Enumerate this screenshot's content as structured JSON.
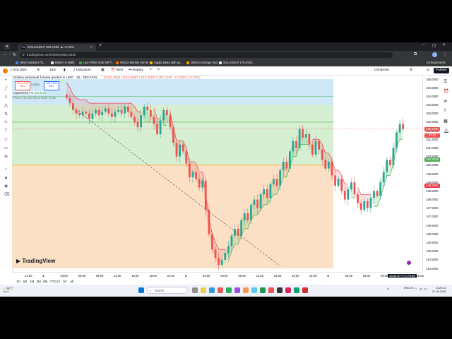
{
  "browser": {
    "tab_title": "SOLUSDLP 152.1200 ▲+2.04%",
    "url": "tradingview.com/chart/OMELN6N/",
    "all_bookmarks": "All Bookmarks",
    "bookmarks": [
      "Hindi Numbers To...",
      "Bihari | e-Nidhi",
      "Live FREE NSE NIFT...",
      "WSO2 Identity Server",
      "Sujala baiku with yu...",
      "Delta Exchange mid...",
      "SOLUSDLP 178.6150..."
    ]
  },
  "header": {
    "symbol": "SOLUSD",
    "interval": "15m",
    "indicators": "Indicators",
    "alert": "Alert",
    "replay": "Replay",
    "layout_name": "Unnamed",
    "publish": "Publish"
  },
  "legend": {
    "title": "Solana perpetual futures quoted in USD · 15 · DELTAIN",
    "ohlc": "O152.4610 H152.5860 L152.0400 C152.1200 −0.3300 (−0.22%)",
    "sell_price": "152.1 000",
    "sell_label": "SELL",
    "spread": "0.0250",
    "buy_price": "152.1250",
    "buy_label": "BUY",
    "indicator1": "Supertrend 7 5",
    "indicator1_value": "150.3018",
    "indicator2": "Pivot 4 30 180 show close mode"
  },
  "price_axis": {
    "labels": [
      "155.0000",
      "154.5000",
      "154.0000",
      "153.5000",
      "153.0000",
      "152.5000",
      "152.0000",
      "151.5000",
      "151.0000",
      "150.5000",
      "150.0000",
      "149.5000",
      "149.0000",
      "148.5000",
      "148.0000",
      "147.5000",
      "147.0000",
      "146.5000",
      "146.0000",
      "145.5000",
      "145.0000",
      "144.5000",
      "144.0000"
    ],
    "current_price": "152.1200",
    "countdown": "03:17",
    "supertrend_tag": "150.3018",
    "red_tag": "148.8000"
  },
  "time_axis": {
    "labels": [
      "21:00",
      "3",
      "03:00",
      "06:00",
      "09:00",
      "12:00",
      "15:00",
      "18:00",
      "21:00",
      "4",
      "03:00",
      "06:00",
      "09:00",
      "12:00",
      "15:00",
      "18:00",
      "21:00",
      "5",
      "03:00",
      "06:00",
      "09:00",
      "12:00",
      "15:00"
    ],
    "cursor_time": "13:22:45 UTC+5:30"
  },
  "watermark": "TradingView",
  "ranges": [
    "1D",
    "5D",
    "1M",
    "3M",
    "6M",
    "YTD",
    "1Y",
    "5Y",
    "All"
  ],
  "bottom_tabs": [
    "Crypto Pairs Screener",
    "Pine Editor",
    "Strategy Tester",
    "Replay Trading",
    "Trading Panel"
  ],
  "taskbar": {
    "weather_temp": "28°C",
    "weather_desc": "Haze",
    "search_placeholder": "Search",
    "lang": "ENG IN",
    "time": "13:22:44",
    "date": "07-06-2025"
  },
  "colors": {
    "candle_up": "#26a69a",
    "candle_down": "#ef5350",
    "supertrend_up": "#4caf50",
    "supertrend_down": "#f23645",
    "band_blue": "#cfe8f5",
    "band_green": "#d6efd2",
    "band_orange": "#fbe0c5"
  },
  "chart_data": {
    "type": "candlestick",
    "y_range": [
      144.0,
      155.0
    ],
    "close_series": [
      153.9,
      153.6,
      153.2,
      153.0,
      152.9,
      153.1,
      153.0,
      152.7,
      153.0,
      153.2,
      152.9,
      153.1,
      153.3,
      153.0,
      152.8,
      153.1,
      153.2,
      153.0,
      153.4,
      153.1,
      152.8,
      152.5,
      152.2,
      152.9,
      153.4,
      153.2,
      152.8,
      152.4,
      151.8,
      152.6,
      153.2,
      152.9,
      152.2,
      151.3,
      150.5,
      151.2,
      150.8,
      150.1,
      149.3,
      149.6,
      149.2,
      148.7,
      149.1,
      147.4,
      146.0,
      145.1,
      144.6,
      144.2,
      144.5,
      144.9,
      145.3,
      145.9,
      146.3,
      145.9,
      146.8,
      147.2,
      146.8,
      147.7,
      148.0,
      147.5,
      148.3,
      148.6,
      148.1,
      148.9,
      149.2,
      148.8,
      149.7,
      150.2,
      149.8,
      150.8,
      151.4,
      151.0,
      152.1,
      151.6,
      151.8,
      151.2,
      150.6,
      151.4,
      150.9,
      150.3,
      149.8,
      150.2,
      149.4,
      148.8,
      149.2,
      148.5,
      148.0,
      148.6,
      149.0,
      148.3,
      147.8,
      147.4,
      147.9,
      147.5,
      148.1,
      148.5,
      148.2,
      149.0,
      149.6,
      150.3,
      150.0,
      151.0,
      151.9,
      152.4,
      152.1
    ]
  }
}
